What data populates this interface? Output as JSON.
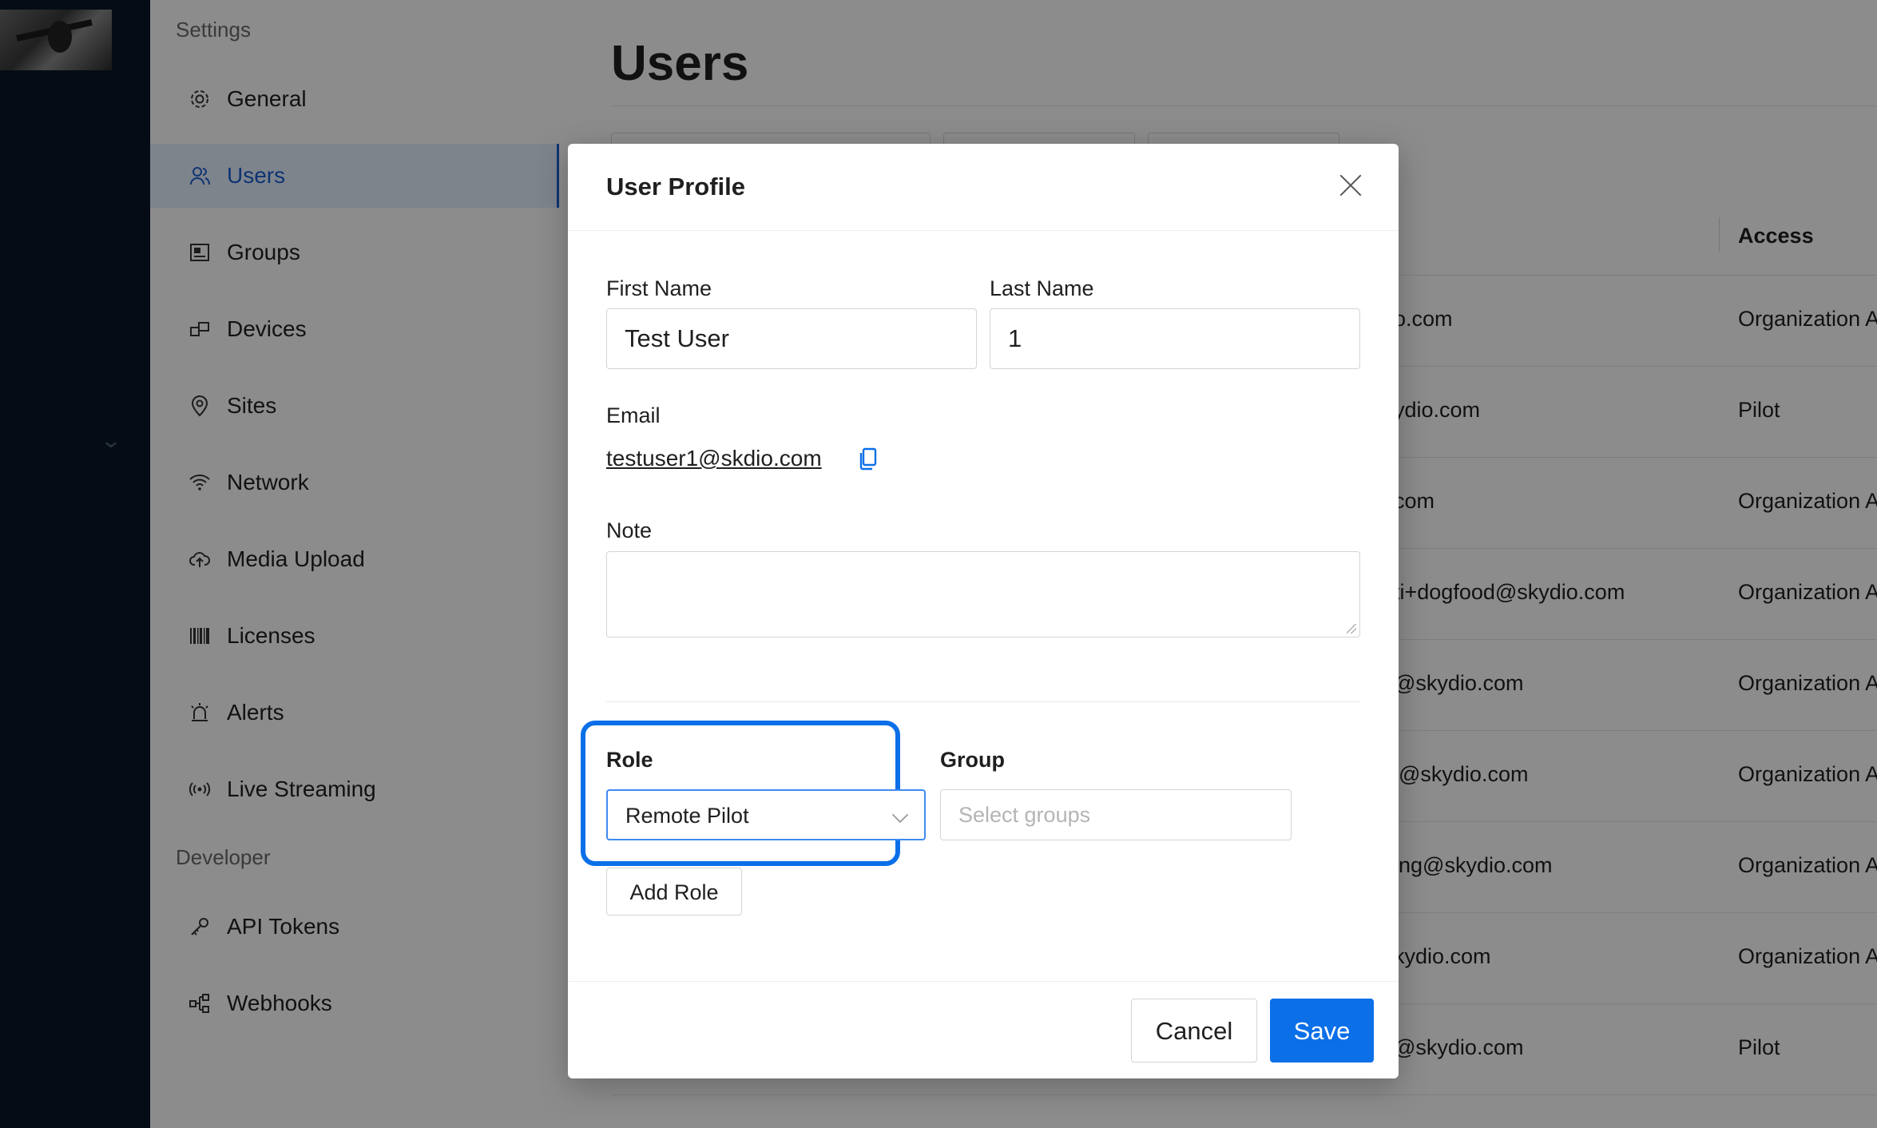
{
  "sidebar": {
    "section_settings": "Settings",
    "section_developer": "Developer",
    "items": [
      {
        "label": "General",
        "icon": "gear-icon"
      },
      {
        "label": "Users",
        "icon": "users-icon",
        "active": true
      },
      {
        "label": "Groups",
        "icon": "groups-icon"
      },
      {
        "label": "Devices",
        "icon": "devices-icon"
      },
      {
        "label": "Sites",
        "icon": "location-pin-icon"
      },
      {
        "label": "Network",
        "icon": "wifi-icon"
      },
      {
        "label": "Media Upload",
        "icon": "cloud-upload-icon"
      },
      {
        "label": "Licenses",
        "icon": "barcode-icon"
      },
      {
        "label": "Alerts",
        "icon": "alarm-icon"
      },
      {
        "label": "Live Streaming",
        "icon": "broadcast-icon"
      }
    ],
    "dev_items": [
      {
        "label": "API Tokens",
        "icon": "key-icon"
      },
      {
        "label": "Webhooks",
        "icon": "webhook-icon"
      }
    ]
  },
  "main": {
    "title": "Users",
    "access_header": "Access",
    "rows": [
      {
        "email": "o.com",
        "access": "Organization A"
      },
      {
        "email": "ydio.com",
        "access": "Pilot"
      },
      {
        "email": "com",
        "access": "Organization A"
      },
      {
        "email": "ti+dogfood@skydio.com",
        "access": "Organization A"
      },
      {
        "email": "@skydio.com",
        "access": "Organization A"
      },
      {
        "email": "l@skydio.com",
        "access": "Organization A"
      },
      {
        "email": "ing@skydio.com",
        "access": "Organization A"
      },
      {
        "email": "kydio.com",
        "access": "Organization A"
      },
      {
        "email": "@skydio.com",
        "access": "Pilot"
      }
    ]
  },
  "modal": {
    "title": "User Profile",
    "first_name_label": "First Name",
    "first_name_value": "Test User",
    "last_name_label": "Last Name",
    "last_name_value": "1",
    "email_label": "Email",
    "email_value": "testuser1@skdio.com",
    "note_label": "Note",
    "note_value": "",
    "role_label": "Role",
    "role_value": "Remote Pilot",
    "group_label": "Group",
    "group_placeholder": "Select groups",
    "add_role_label": "Add Role",
    "cancel_label": "Cancel",
    "save_label": "Save"
  },
  "colors": {
    "primary": "#0b6fe8",
    "rail": "#0a1628",
    "active_nav_bg": "#e6f0ff"
  }
}
